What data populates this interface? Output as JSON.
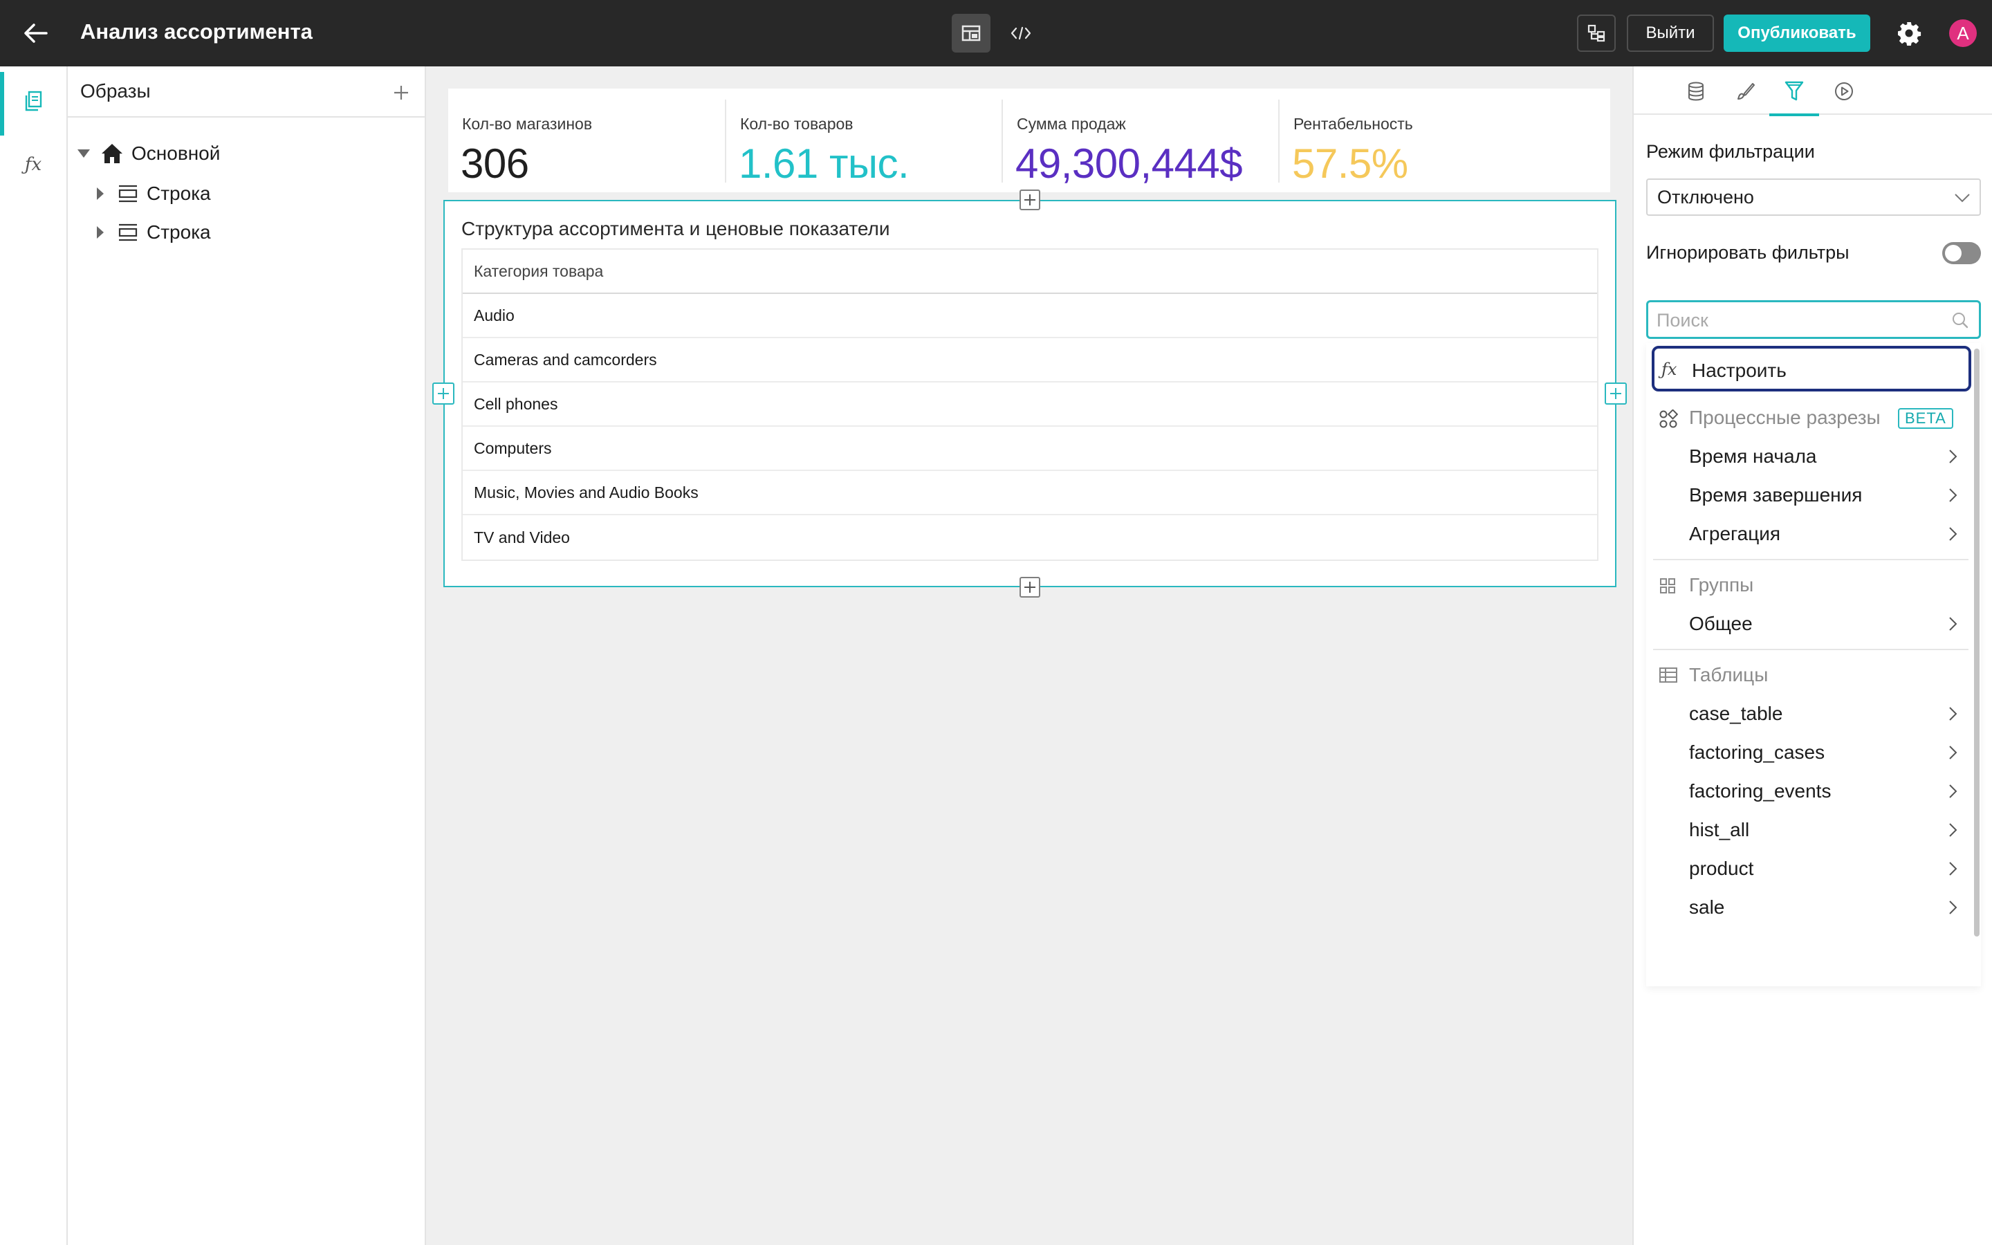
{
  "header": {
    "title": "Анализ ассортимента",
    "exit_label": "Выйти",
    "publish_label": "Опубликовать",
    "avatar_letter": "A"
  },
  "tree": {
    "title": "Образы",
    "items": [
      {
        "label": "Основной"
      },
      {
        "label": "Строка"
      },
      {
        "label": "Строка"
      }
    ]
  },
  "kpis": [
    {
      "label": "Кол-во магазинов",
      "value": "306",
      "color": "#1f1f1f"
    },
    {
      "label": "Кол-во товаров",
      "value": "1.61 тыс.",
      "color": "#22c1c8"
    },
    {
      "label": "Сумма продаж",
      "value": "49,300,444$",
      "color": "#5a2fc2"
    },
    {
      "label": "Рентабельность",
      "value": "57.5%",
      "color": "#f5c85a"
    }
  ],
  "widget": {
    "title": "Структура ассортимента и ценовые показатели",
    "column_header": "Категория товара",
    "rows": [
      "Audio",
      "Cameras and camcorders",
      "Cell phones",
      "Computers",
      "Music, Movies and Audio Books",
      "TV and Video"
    ]
  },
  "right_panel": {
    "filter_mode_label": "Режим фильтрации",
    "filter_mode_value": "Отключено",
    "ignore_filters_label": "Игнорировать фильтры",
    "ignore_filters_on": false,
    "search_placeholder": "Поиск",
    "dropdown": {
      "configure_label": "Настроить",
      "process_group": "Процессные разрезы",
      "beta_label": "BETA",
      "process_items": [
        "Время начала",
        "Время завершения",
        "Агрегация"
      ],
      "groups_group": "Группы",
      "groups_items": [
        "Общее"
      ],
      "tables_group": "Таблицы",
      "tables_items": [
        "case_table",
        "factoring_cases",
        "factoring_events",
        "hist_all",
        "product",
        "sale"
      ]
    }
  },
  "colors": {
    "accent": "#15b8b8",
    "topbar": "#282828",
    "focus_outline": "#1d2f7e"
  }
}
